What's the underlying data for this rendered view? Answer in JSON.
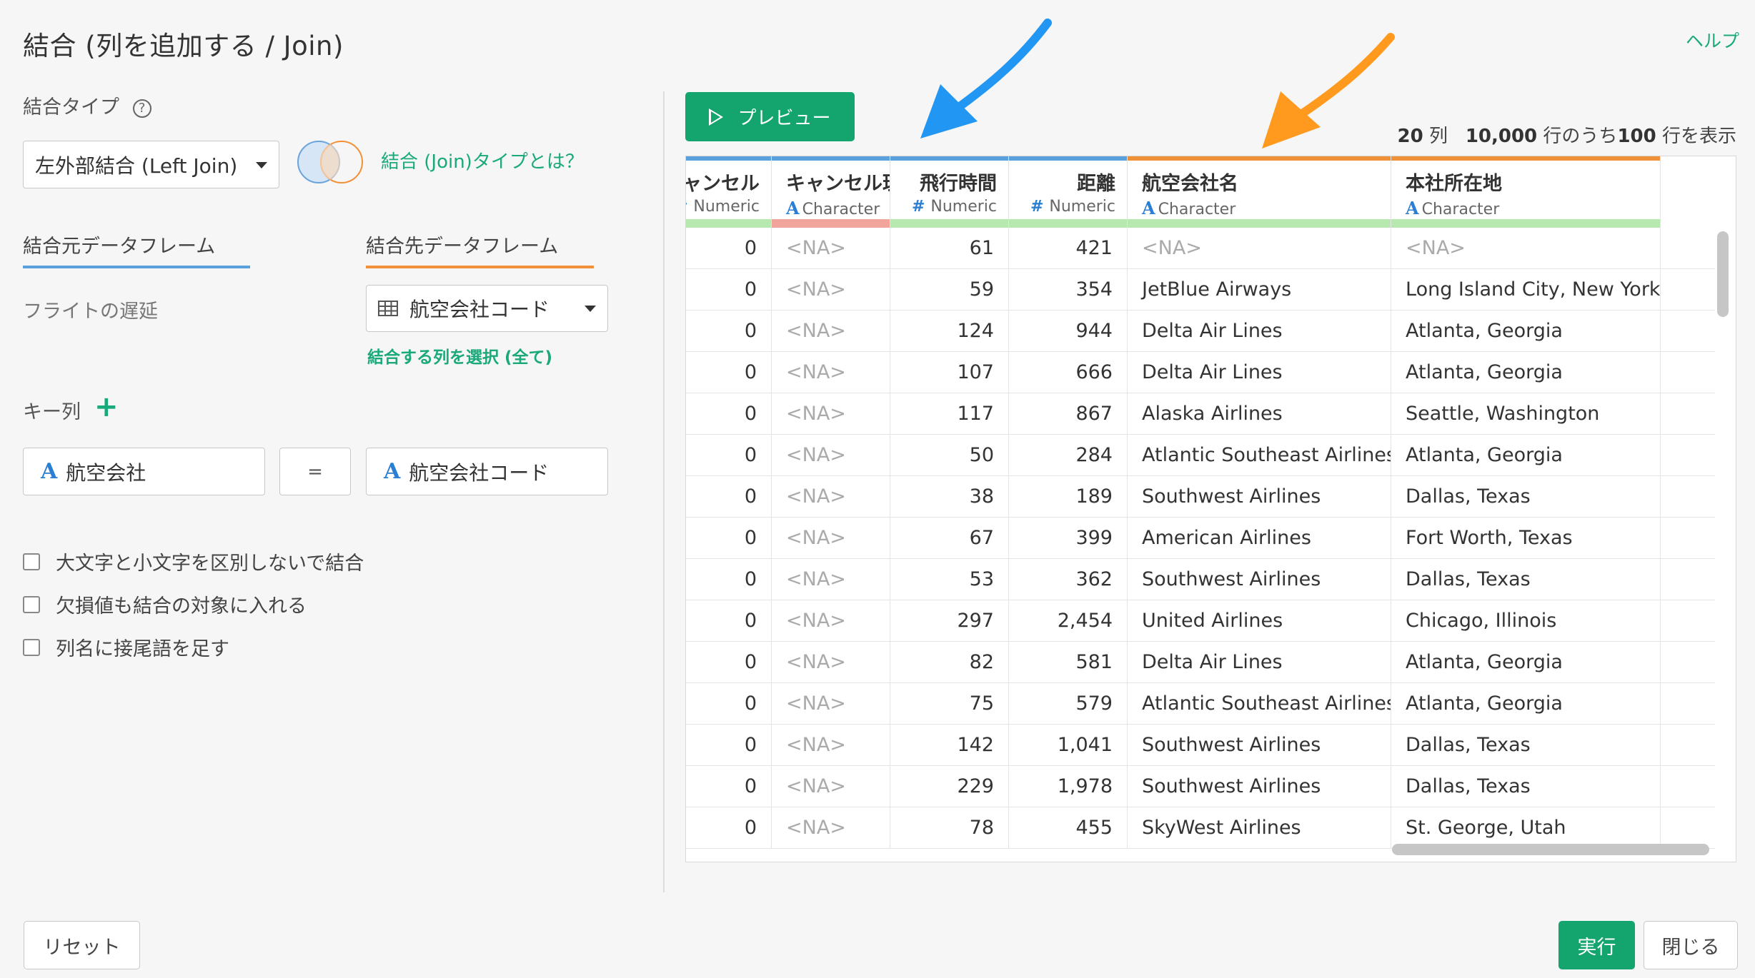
{
  "header": {
    "title": "結合 (列を追加する / Join)",
    "help": "ヘルプ"
  },
  "join_type": {
    "label": "結合タイプ",
    "help_icon": "?",
    "selected": "左外部結合 (Left Join)",
    "info_link": "結合 (Join)タイプとは？"
  },
  "source": {
    "tab_label": "結合元データフレーム",
    "value": "フライトの遅延"
  },
  "target": {
    "tab_label": "結合先データフレーム",
    "selected": "航空会社コード",
    "select_columns": "結合する列を選択 (全て)"
  },
  "key": {
    "label": "キー列",
    "left_type": "A",
    "left": "航空会社",
    "equals": "=",
    "right_type": "A",
    "right": "航空会社コード"
  },
  "options": [
    {
      "label": "大文字と小文字を区別しないで結合",
      "checked": false
    },
    {
      "label": "欠損値も結合の対象に入れる",
      "checked": false
    },
    {
      "label": "列名に接尾語を足す",
      "checked": false
    }
  ],
  "preview": {
    "button": "プレビュー",
    "cols_count": "20",
    "cols_unit": "列",
    "rows_total": "10,000",
    "rows_mid": "行のうち",
    "rows_shown": "100",
    "rows_unit": "行を表示"
  },
  "table": {
    "columns": [
      {
        "name": "ャンセル",
        "type_icon": "#",
        "type": "Numeric",
        "top_color": "#5aa0dc",
        "bottom_color": "#b6e8b0"
      },
      {
        "name": "キャンセル理由",
        "type_icon": "A",
        "type": "Character",
        "top_color": "#5aa0dc",
        "bottom_color": "#f0a49c"
      },
      {
        "name": "飛行時間",
        "type_icon": "#",
        "type": "Numeric",
        "top_color": "#5aa0dc",
        "bottom_color": "#b6e8b0"
      },
      {
        "name": "距離",
        "type_icon": "#",
        "type": "Numeric",
        "top_color": "#5aa0dc",
        "bottom_color": "#b6e8b0"
      },
      {
        "name": "航空会社名",
        "type_icon": "A",
        "type": "Character",
        "top_color": "#f0913a",
        "bottom_color": "#b6e8b0"
      },
      {
        "name": "本社所在地",
        "type_icon": "A",
        "type": "Character",
        "top_color": "#f0913a",
        "bottom_color": "#b6e8b0"
      }
    ],
    "rows": [
      [
        "0",
        "<NA>",
        "61",
        "421",
        "<NA>",
        "<NA>"
      ],
      [
        "0",
        "<NA>",
        "59",
        "354",
        "JetBlue Airways",
        "Long Island City, New York"
      ],
      [
        "0",
        "<NA>",
        "124",
        "944",
        "Delta Air Lines",
        "Atlanta, Georgia"
      ],
      [
        "0",
        "<NA>",
        "107",
        "666",
        "Delta Air Lines",
        "Atlanta, Georgia"
      ],
      [
        "0",
        "<NA>",
        "117",
        "867",
        "Alaska Airlines",
        "Seattle, Washington"
      ],
      [
        "0",
        "<NA>",
        "50",
        "284",
        "Atlantic Southeast Airlines",
        "Atlanta, Georgia"
      ],
      [
        "0",
        "<NA>",
        "38",
        "189",
        "Southwest Airlines",
        "Dallas, Texas"
      ],
      [
        "0",
        "<NA>",
        "67",
        "399",
        "American Airlines",
        "Fort Worth, Texas"
      ],
      [
        "0",
        "<NA>",
        "53",
        "362",
        "Southwest Airlines",
        "Dallas, Texas"
      ],
      [
        "0",
        "<NA>",
        "297",
        "2,454",
        "United Airlines",
        "Chicago, Illinois"
      ],
      [
        "0",
        "<NA>",
        "82",
        "581",
        "Delta Air Lines",
        "Atlanta, Georgia"
      ],
      [
        "0",
        "<NA>",
        "75",
        "579",
        "Atlantic Southeast Airlines",
        "Atlanta, Georgia"
      ],
      [
        "0",
        "<NA>",
        "142",
        "1,041",
        "Southwest Airlines",
        "Dallas, Texas"
      ],
      [
        "0",
        "<NA>",
        "229",
        "1,978",
        "Southwest Airlines",
        "Dallas, Texas"
      ],
      [
        "0",
        "<NA>",
        "78",
        "455",
        "SkyWest Airlines",
        "St. George, Utah"
      ]
    ]
  },
  "annotations": {
    "arrow_left_color": "#2196f3",
    "arrow_right_color": "#ff9a1f"
  },
  "footer": {
    "reset": "リセット",
    "run": "実行",
    "close": "閉じる"
  },
  "colors": {
    "accent": "#14a56e",
    "link": "#1aa97a",
    "source_tab": "#5aa0dc",
    "target_tab": "#f0913a"
  }
}
